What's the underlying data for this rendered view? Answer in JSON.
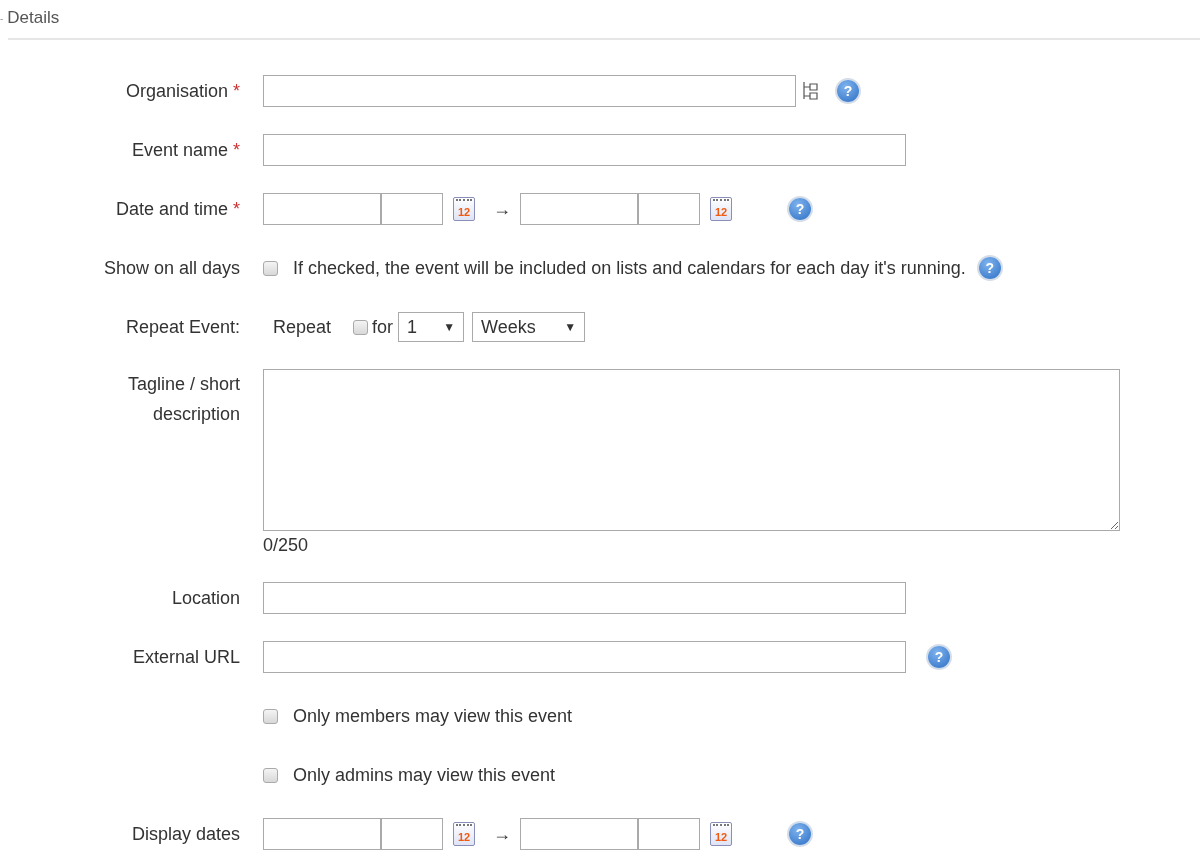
{
  "section": {
    "marker": "-",
    "title": "Details"
  },
  "fields": [
    {
      "kind": "org",
      "label": "Organisation",
      "required_mark": "*",
      "help": "?"
    },
    {
      "kind": "text",
      "label": "Event name",
      "required_mark": "*"
    },
    {
      "kind": "daterange",
      "label": "Date and time",
      "required_mark": "*",
      "start_calendar": "12",
      "arrow": "→",
      "end_calendar": "12",
      "help": "?"
    },
    {
      "kind": "check",
      "label": "Show on all days",
      "checked": false,
      "text": "If checked, the event will be included on lists and calendars for each day it's running.",
      "help": "?"
    },
    {
      "kind": "repeat",
      "label": "Repeat Event:",
      "repeat_label": "Repeat",
      "checked": false,
      "for_label": "for",
      "count": "1",
      "count_caret": "▼",
      "unit": "Weeks",
      "unit_caret": "▼"
    },
    {
      "kind": "textarea",
      "label": "Tagline / short description",
      "counter": "0/250"
    },
    {
      "kind": "text",
      "label": "Location"
    },
    {
      "kind": "text",
      "label": "External URL",
      "help": "?"
    },
    {
      "kind": "check",
      "checked": false,
      "text": "Only members may view this event"
    },
    {
      "kind": "check",
      "checked": false,
      "text": "Only admins may view this event"
    },
    {
      "kind": "daterange",
      "label": "Display dates",
      "start_calendar": "12",
      "arrow": "→",
      "end_calendar": "12",
      "help": "?"
    }
  ]
}
